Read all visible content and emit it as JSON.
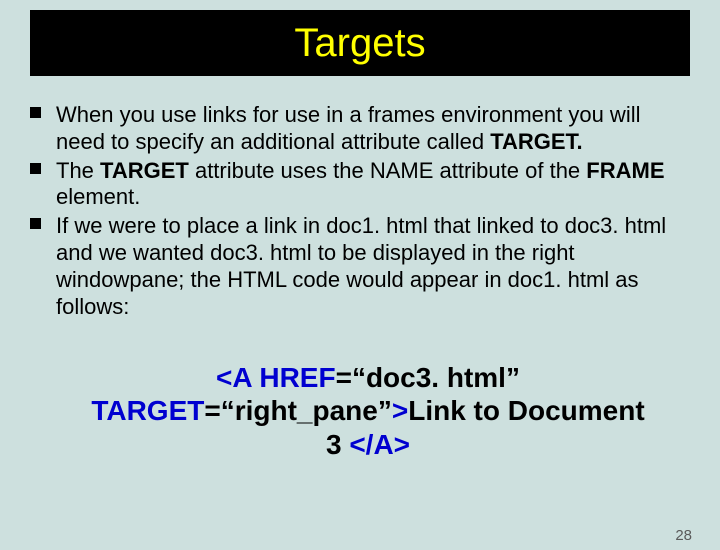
{
  "title": "Targets",
  "bullets": [
    {
      "pre": "When you use links for use in a frames environment you will need to specify an additional attribute called ",
      "bold": "TARGET."
    },
    {
      "pre": "The ",
      "bold1": "TARGET",
      "mid": " attribute uses the NAME attribute of the ",
      "bold2": "FRAME",
      "post": " element."
    },
    {
      "text": "If we were to place a link in doc1. html that linked to doc3. html and we wanted doc3. html to be displayed in the right windowpane; the HTML code would appear in doc1. html as follows:"
    }
  ],
  "code": {
    "tag_open": "<A HREF",
    "eq1": "=",
    "val1": "“doc3. html” ",
    "attr2": "TARGET",
    "eq2": "=",
    "val2": "“right_pane”",
    "gt": ">",
    "linktext": "Link to Document 3 ",
    "tag_close": "</A>"
  },
  "page_number": "28"
}
